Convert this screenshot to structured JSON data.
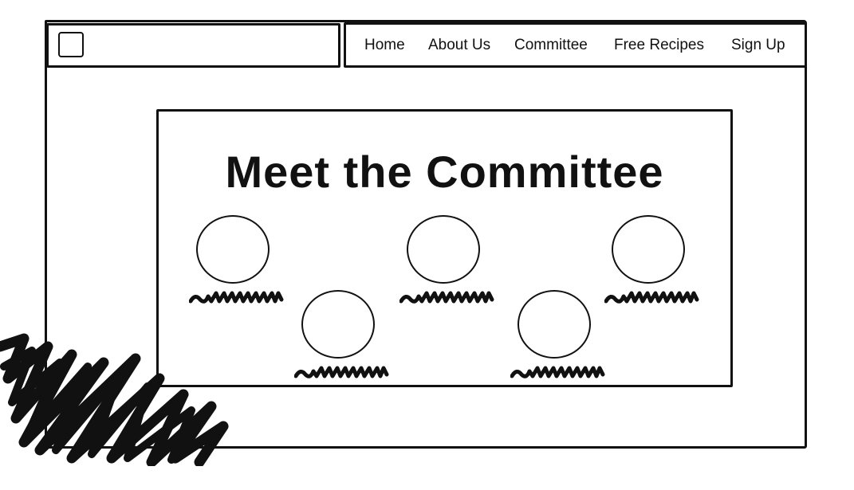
{
  "nav": {
    "items": [
      {
        "label": "Home"
      },
      {
        "label": "About Us"
      },
      {
        "label": "Committee"
      },
      {
        "label": "Free Recipes"
      },
      {
        "label": "Sign Up"
      }
    ]
  },
  "main": {
    "title": "Meet the Committee",
    "member_count": 5
  },
  "icons": {
    "logo": "logo-placeholder-icon",
    "avatar": "person-placeholder-icon",
    "name": "name-placeholder-squiggle",
    "decoration": "scribble-decoration"
  },
  "colors": {
    "ink": "#111111",
    "background": "#ffffff"
  }
}
